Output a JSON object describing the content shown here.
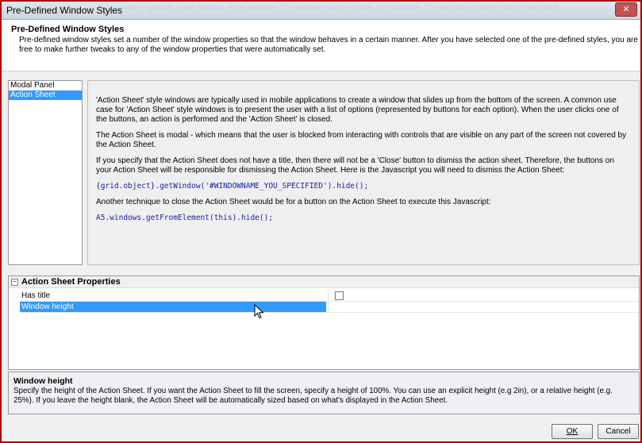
{
  "window": {
    "title": "Pre-Defined Window Styles",
    "background_title_text": "(wen a generic, user defined, large window. The window can be modal, or modeless. The window content can be specified",
    "close_label": "✕"
  },
  "header": {
    "title": "Pre-Defined Window Styles",
    "description": "Pre-defined window styles set a number of the window properties so that the window behaves in a certain manner. After you have selected one of the pre-defined styles, you are free to make further tweaks to any of the window properties that were automatically set."
  },
  "style_list": {
    "items": [
      {
        "label": "Modal Panel",
        "selected": false
      },
      {
        "label": "Action Sheet",
        "selected": true
      }
    ]
  },
  "description_panel": {
    "para1": "'Action Sheet' style windows are typically used in mobile applications to create a window that slides up from the bottom of the screen. A common use case for 'Action Sheet' style windows is to present the user with a list of options (represented by buttons for each option). When the user clicks one of the buttons, an action is performed and the 'Action Sheet' is closed.",
    "para2": "The Action Sheet is modal - which means that the user is blocked from interacting with controls that are visible on any part of the screen not covered by the Action Sheet.",
    "para3": "If you specify that the Action Sheet does not have a title, then there will not be a 'Close' button to dismiss the action sheet. Therefore, the buttons on your Action Sheet will be responsible for dismissing the Action Sheet. Here is the Javascript you will need to dismiss the Action Sheet:",
    "code1": "{grid.object}.getWindow('#WINDOWNAME_YOU_SPECIFIED').hide();",
    "para4": "Another technique to close the Action Sheet would be for a button on the Action Sheet to execute this Javascript:",
    "code2": "A5.windows.getFromElement(this).hide();"
  },
  "properties": {
    "section_title": "Action Sheet Properties",
    "collapse_glyph": "−",
    "rows": [
      {
        "label": "Has title",
        "type": "checkbox",
        "checked": false,
        "selected": false
      },
      {
        "label": "Window height",
        "type": "text",
        "value": "",
        "selected": true
      }
    ]
  },
  "help": {
    "title": "Window height",
    "text": "Specify the height of the Action Sheet. If you want the Action Sheet to fill the screen, specify a height of 100%. You can use an explicit height (e.g 2in), or a relative height (e.g. 25%). If you leave the height blank, the Action Sheet will be automatically sized based on what's displayed in the Action Sheet."
  },
  "buttons": {
    "ok_label": "OK",
    "cancel_label": "Cancel"
  },
  "colors": {
    "selection": "#3399ff",
    "code": "#1a22a8",
    "outer_border": "#aa0000"
  }
}
